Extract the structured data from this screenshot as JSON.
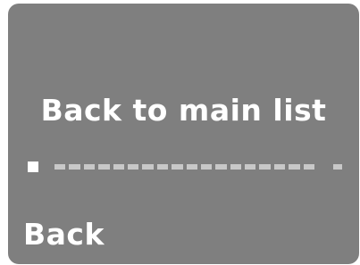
{
  "screen": {
    "title": "Back to main list",
    "back_label": "Back",
    "progress": {
      "segments_total": 20,
      "current_index": 0
    },
    "colors": {
      "panel_bg": "#7f7f7f",
      "text": "#ffffff",
      "inactive_segment": "#c8c8c8"
    },
    "icons": {
      "cursor": "square-indicator"
    }
  }
}
